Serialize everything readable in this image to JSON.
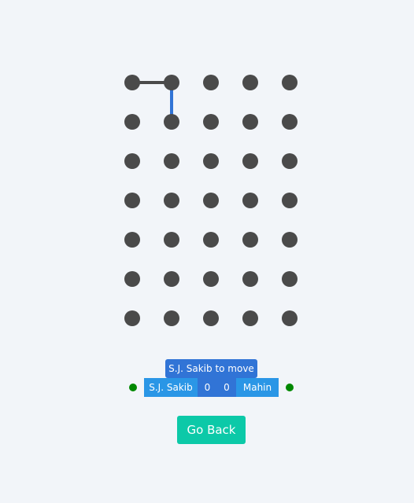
{
  "board": {
    "rows": 7,
    "cols": 5,
    "dot_color": "#4a4a4a",
    "lines": [
      {
        "from": [
          0,
          0
        ],
        "to": [
          0,
          1
        ],
        "player": "S.J. Sakib",
        "color": "#4a4a4a"
      },
      {
        "from": [
          0,
          1
        ],
        "to": [
          1,
          1
        ],
        "player": "Mahin",
        "color": "#3174d6"
      }
    ]
  },
  "status": {
    "turn_text": "S.J. Sakib to move"
  },
  "players": [
    {
      "name": "S.J. Sakib",
      "score": "0",
      "indicator_color": "#008800"
    },
    {
      "name": "Mahin",
      "score": "0",
      "indicator_color": "#008800"
    }
  ],
  "actions": {
    "back_label": "Go Back"
  },
  "colors": {
    "background": "#f2f5f9",
    "banner": "#3174d6",
    "name_cell": "#2a96e6",
    "button": "#0cc9a8"
  }
}
